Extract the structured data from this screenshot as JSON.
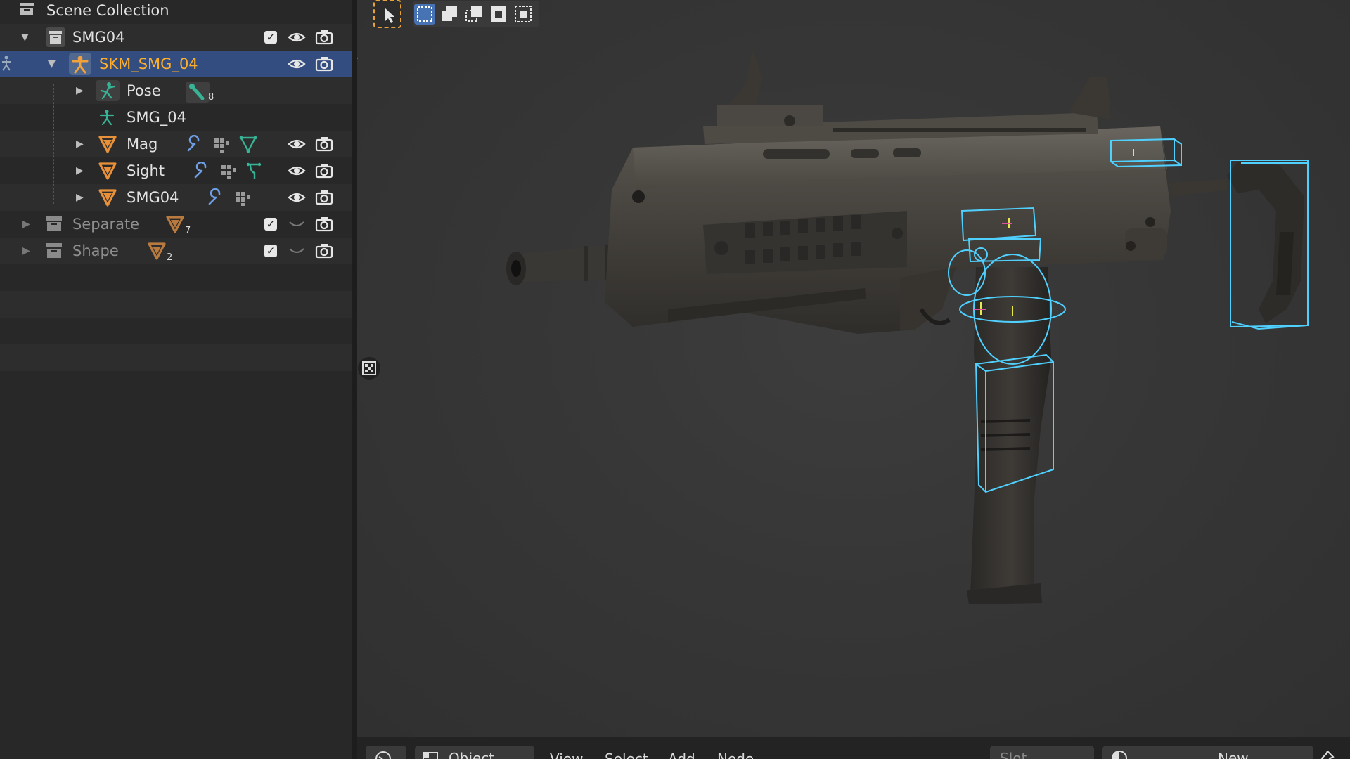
{
  "outliner": {
    "scene_collection": "Scene Collection",
    "rows": {
      "smg04": {
        "label": "SMG04"
      },
      "skm": {
        "label": "SKM_SMG_04"
      },
      "pose": {
        "label": "Pose",
        "badge_count": "8"
      },
      "armature": {
        "label": "SMG_04"
      },
      "mag": {
        "label": "Mag"
      },
      "sight": {
        "label": "Sight"
      },
      "smg04mesh": {
        "label": "SMG04"
      },
      "separate": {
        "label": "Separate",
        "badge_count": "7"
      },
      "shape": {
        "label": "Shape",
        "badge_count": "2"
      }
    }
  },
  "header": {
    "mode": "Object",
    "menus": [
      "View",
      "Select",
      "Add",
      "Node"
    ],
    "slot_placeholder": "Slot",
    "new_label": "New"
  },
  "colors": {
    "selection": "#334d80",
    "active_object_text": "#ffaf29",
    "mesh_icon": "#e8913a",
    "armature_icon": "#37b495",
    "modifier_icon": "#6e9fe6",
    "bounding_box": "#4fd0ff"
  }
}
